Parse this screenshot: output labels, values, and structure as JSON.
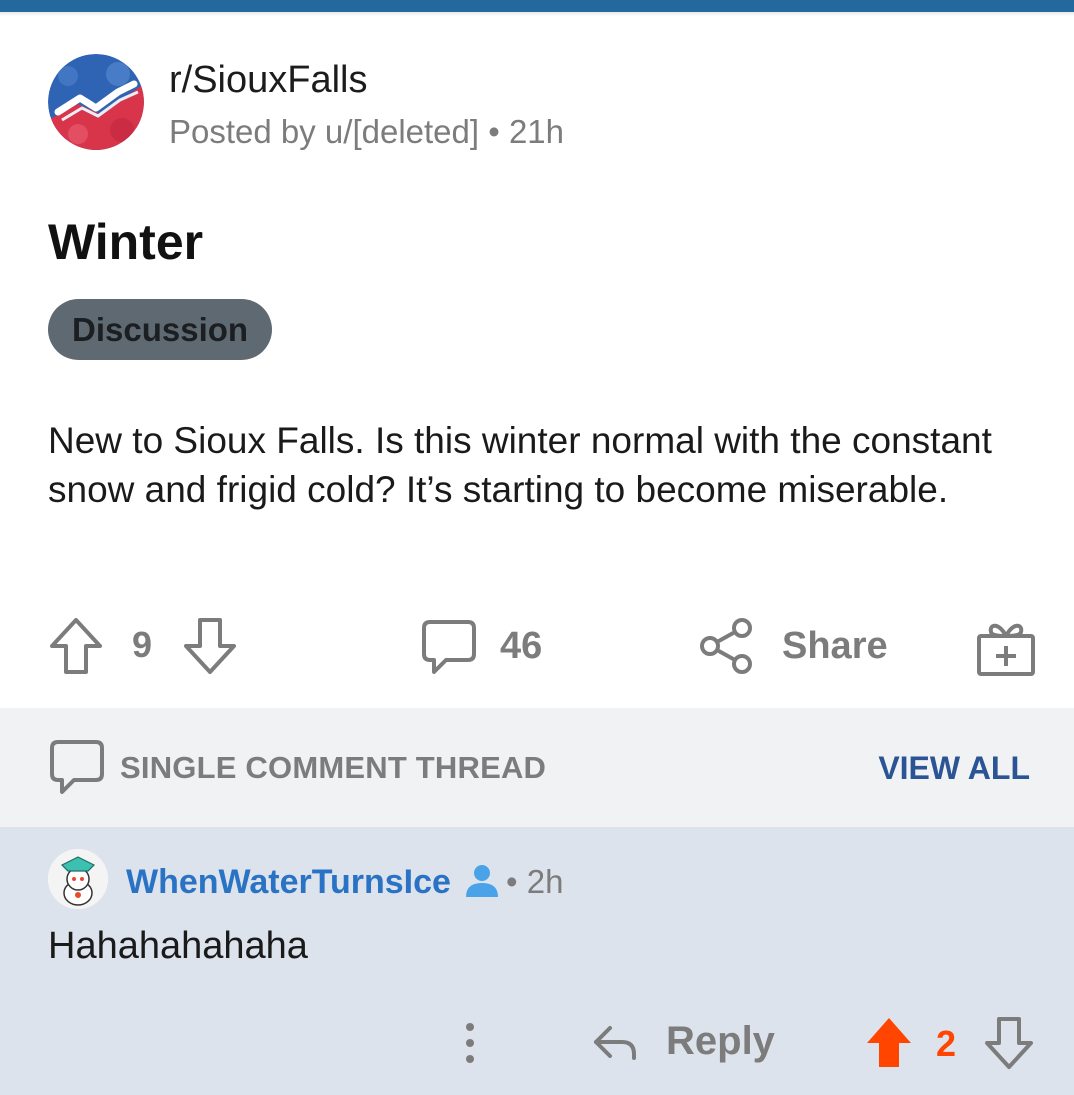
{
  "colors": {
    "topbar": "#24699e",
    "flair_bg": "#5f6972",
    "thread_bar_bg": "#f0f2f4",
    "comment_bg": "#dde3ec",
    "author_blue": "#2a73c4",
    "view_all_blue": "#2a5494",
    "upvote_active": "#ff4500",
    "meta_gray": "#7c7c7c"
  },
  "post": {
    "subreddit": "r/SiouxFalls",
    "posted_by": "Posted by u/[deleted] • 21h",
    "title": "Winter",
    "flair": "Discussion",
    "body": "New to Sioux Falls. Is this winter normal with the constant snow and frigid cold? It’s starting to become miserable.",
    "score": "9",
    "comment_count": "46",
    "share_label": "Share",
    "icons": {
      "upvote": "arrow-up-outline-icon",
      "downvote": "arrow-down-outline-icon",
      "comments": "speech-bubble-icon",
      "share": "share-nodes-icon",
      "award": "gift-box-icon"
    }
  },
  "thread_bar": {
    "label": "SINGLE COMMENT THREAD",
    "view_all": "VIEW ALL"
  },
  "comment": {
    "author": "WhenWaterTurnsIce",
    "time": "• 2h",
    "text": "Hahahahahaha",
    "reply_label": "Reply",
    "score": "2"
  }
}
